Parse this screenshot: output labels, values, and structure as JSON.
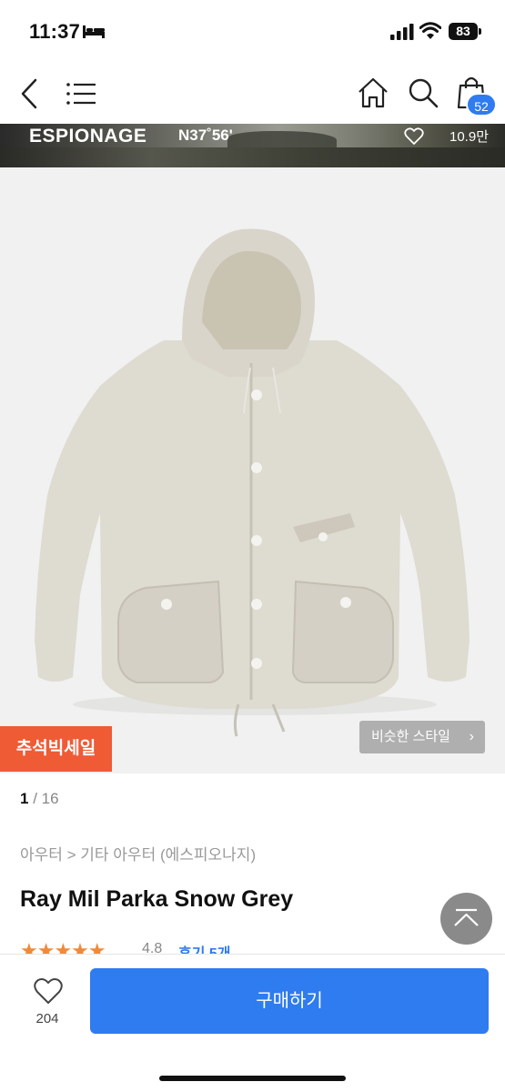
{
  "status_bar": {
    "time": "11:37",
    "battery": "83"
  },
  "nav": {
    "cart_count": "52"
  },
  "shop_banner": {
    "name": "ESPIONAGE",
    "sub": "N37˚56'",
    "followers": "10.9만"
  },
  "gallery": {
    "sale_tag": "추석빅세일",
    "similar_style_label": "비슷한 스타일",
    "current": "1",
    "separator": "/",
    "total": "16"
  },
  "product": {
    "category": "아우터 > 기타 아우터 (에스피오나지)",
    "title": "Ray Mil Parka Snow Grey",
    "rating_stars": "★★★★★",
    "rating_value": "4.8",
    "review_label": "후기 5개"
  },
  "bottom_bar": {
    "like_count": "204",
    "buy_label": "구매하기"
  },
  "colors": {
    "accent": "#2f7bf0",
    "sale": "#ef5b35",
    "star": "#f08a3a"
  },
  "icons": [
    "back-icon",
    "menu-icon",
    "home-icon",
    "search-icon",
    "shopping-bag-icon",
    "heart-icon",
    "scroll-top-icon"
  ]
}
